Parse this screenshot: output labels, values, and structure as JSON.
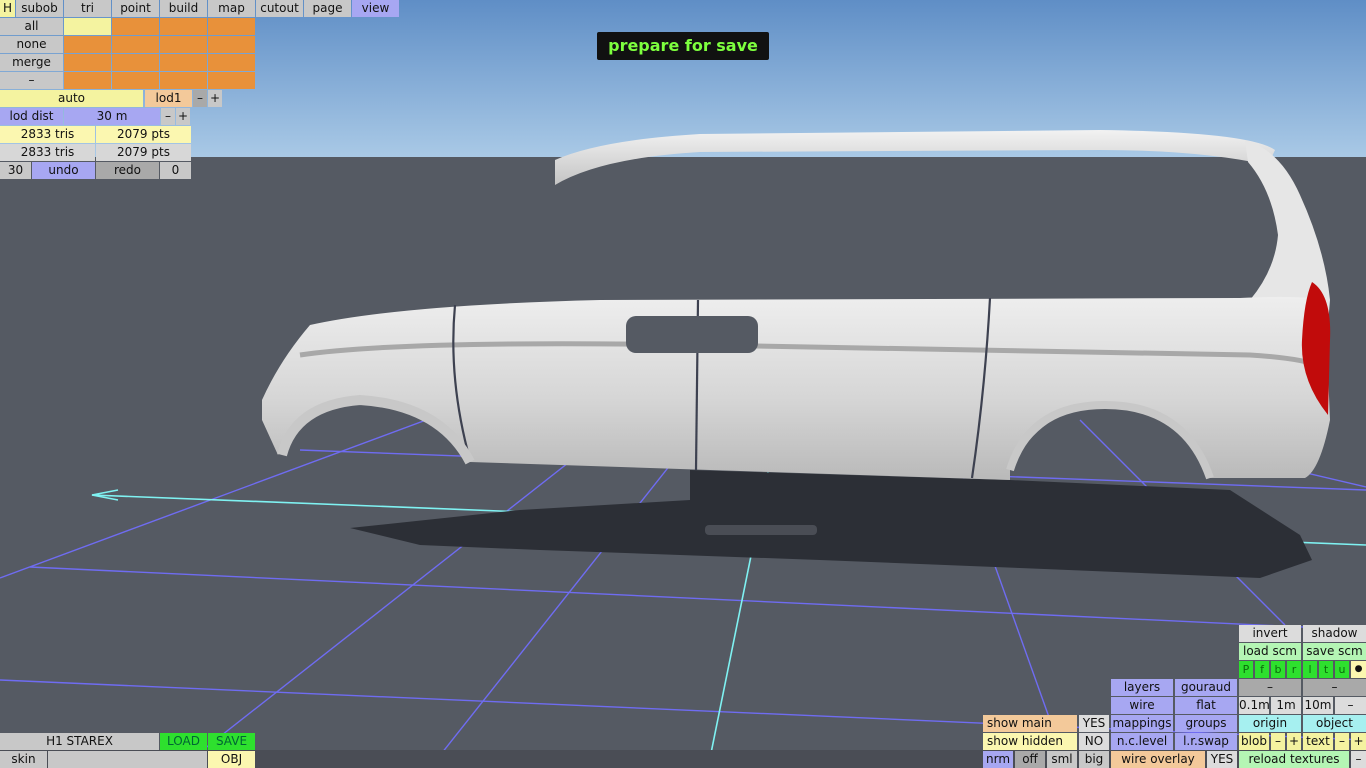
{
  "banner": "prepare for save",
  "top_menu": {
    "h": "H",
    "tabs": [
      "subob",
      "tri",
      "point",
      "build",
      "map",
      "cutout",
      "page",
      "view"
    ],
    "active": "view"
  },
  "selection": {
    "rows": [
      "all",
      "none",
      "merge",
      "–"
    ]
  },
  "lod": {
    "mode": "auto",
    "level": "lod1",
    "minus": "–",
    "plus": "+",
    "dist_label": "lod dist",
    "dist_value": "30 m"
  },
  "stats": {
    "row1": {
      "tris": "2833 tris",
      "pts": "2079 pts"
    },
    "row2": {
      "tris": "2833 tris",
      "pts": "2079 pts"
    }
  },
  "undo_row": {
    "count": "30",
    "undo": "undo",
    "redo": "redo",
    "redo_count": "0"
  },
  "bottom_left": {
    "name": "H1 STAREX",
    "load": "LOAD",
    "save": "SAVE",
    "skin": "skin",
    "obj": "OBJ"
  },
  "view_panel": {
    "invert": "invert",
    "shadow": "shadow",
    "load_scm": "load scm",
    "save_scm": "save scm",
    "views": [
      "P",
      "f",
      "b",
      "r",
      "l",
      "t",
      "u"
    ],
    "dot": "●",
    "layers": "layers",
    "gouraud": "gouraud",
    "dash": "–",
    "wire": "wire",
    "flat": "flat",
    "scales": [
      "0.1m",
      "1m",
      "10m",
      "–"
    ],
    "show_main": "show main",
    "show_main_val": "YES",
    "mappings": "mappings",
    "groups": "groups",
    "origin": "origin",
    "object": "object",
    "show_hidden": "show hidden",
    "show_hidden_val": "NO",
    "nc_level": "n.c.level",
    "lr_swap": "l.r.swap",
    "blob": "blob",
    "text": "text",
    "minus": "–",
    "plus": "+",
    "nrm": "nrm",
    "off": "off",
    "sml": "sml",
    "big": "big",
    "wire_overlay": "wire overlay",
    "wire_overlay_val": "YES",
    "reload_textures": "reload textures"
  },
  "colors": {
    "sky_top": "#5f8ec6",
    "sky_bottom": "#a9c9e6",
    "ground": "#555a63",
    "grid": "#6f6cf2",
    "axis": "#7ff2f2",
    "car_body": "#dcdcdc",
    "tail_light": "#c10b0b",
    "banner_text": "#7dff3e"
  }
}
